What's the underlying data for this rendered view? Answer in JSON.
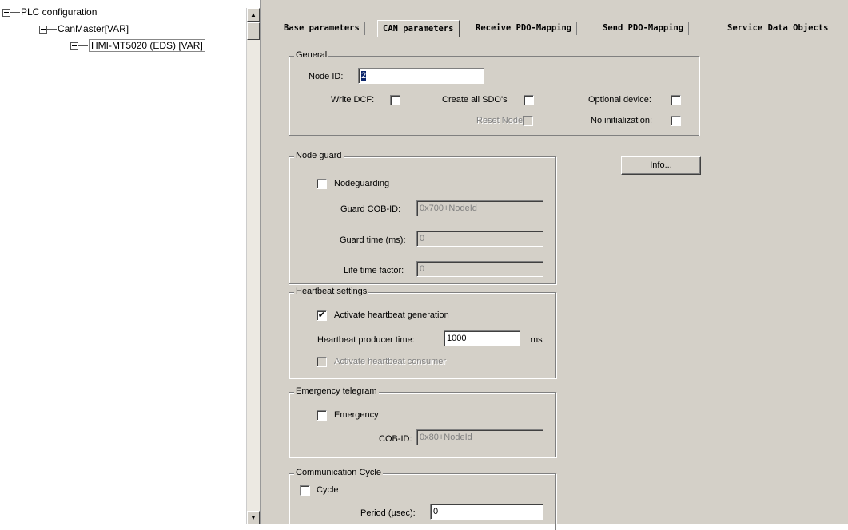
{
  "tree": {
    "root": "PLC configuration",
    "master": "CanMaster[VAR]",
    "node": "HMI-MT5020 (EDS)  [VAR]"
  },
  "tabs": [
    "Base parameters",
    "CAN parameters",
    "Receive PDO-Mapping",
    "Send PDO-Mapping",
    "Service Data Objects"
  ],
  "active_tab": "CAN parameters",
  "general": {
    "title": "General",
    "node_id_label": "Node ID:",
    "node_id_value": "2",
    "write_dcf_label": "Write DCF:",
    "create_sdos_label": "Create all SDO's",
    "optional_device_label": "Optional device:",
    "reset_node_label": "Reset Node:",
    "no_init_label": "No initialization:"
  },
  "node_guard": {
    "title": "Node guard",
    "nodeguarding_label": "Nodeguarding",
    "guard_cob_label": "Guard COB-ID:",
    "guard_cob_value": "0x700+NodeId",
    "guard_time_label": "Guard time (ms):",
    "guard_time_value": "0",
    "life_time_label": "Life time factor:",
    "life_time_value": "0"
  },
  "info_button": "Info...",
  "heartbeat": {
    "title": "Heartbeat settings",
    "activate_gen_label": "Activate heartbeat generation",
    "activate_gen_checked": true,
    "producer_time_label": "Heartbeat producer time:",
    "producer_time_value": "1000",
    "unit": "ms",
    "consumer_label": "Activate heartbeat consumer"
  },
  "emergency": {
    "title": "Emergency telegram",
    "emergency_label": "Emergency",
    "cob_label": "COB-ID:",
    "cob_value": "0x80+NodeId"
  },
  "comm_cycle": {
    "title": "Communication Cycle",
    "cycle_label": "Cycle",
    "period_label": "Period (µsec):",
    "period_value": "0"
  },
  "icons": {
    "scroll_up": "▲",
    "scroll_down": "▼",
    "check": "✔"
  }
}
